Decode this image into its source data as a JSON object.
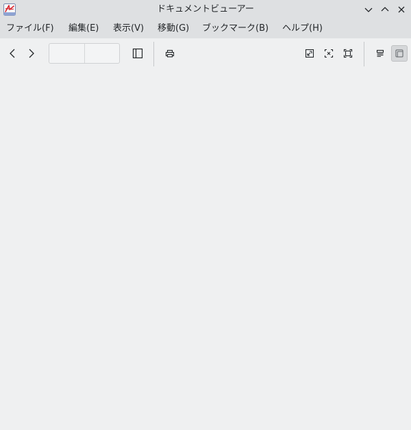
{
  "window": {
    "title": "ドキュメントビューアー"
  },
  "menubar": {
    "items": [
      {
        "label": "ファイル(F)"
      },
      {
        "label": "編集(E)"
      },
      {
        "label": "表示(V)"
      },
      {
        "label": "移動(G)"
      },
      {
        "label": "ブックマーク(B)"
      },
      {
        "label": "ヘルプ(H)"
      }
    ]
  },
  "toolbar": {
    "page_number_value": "",
    "page_count_value": ""
  },
  "colors": {
    "background": "#eff0f1",
    "titlebar": "#dee0e2",
    "icon": "#232629",
    "app_icon_red": "#d9262f"
  },
  "icons": [
    "app-icon",
    "minimize-icon",
    "maximize-icon",
    "close-icon",
    "back-icon",
    "forward-icon",
    "sidebar-toggle-icon",
    "print-icon",
    "zoom-fit-page-icon",
    "zoom-fit-width-icon",
    "fullscreen-icon",
    "annotations-icon",
    "presentation-mode-icon"
  ]
}
